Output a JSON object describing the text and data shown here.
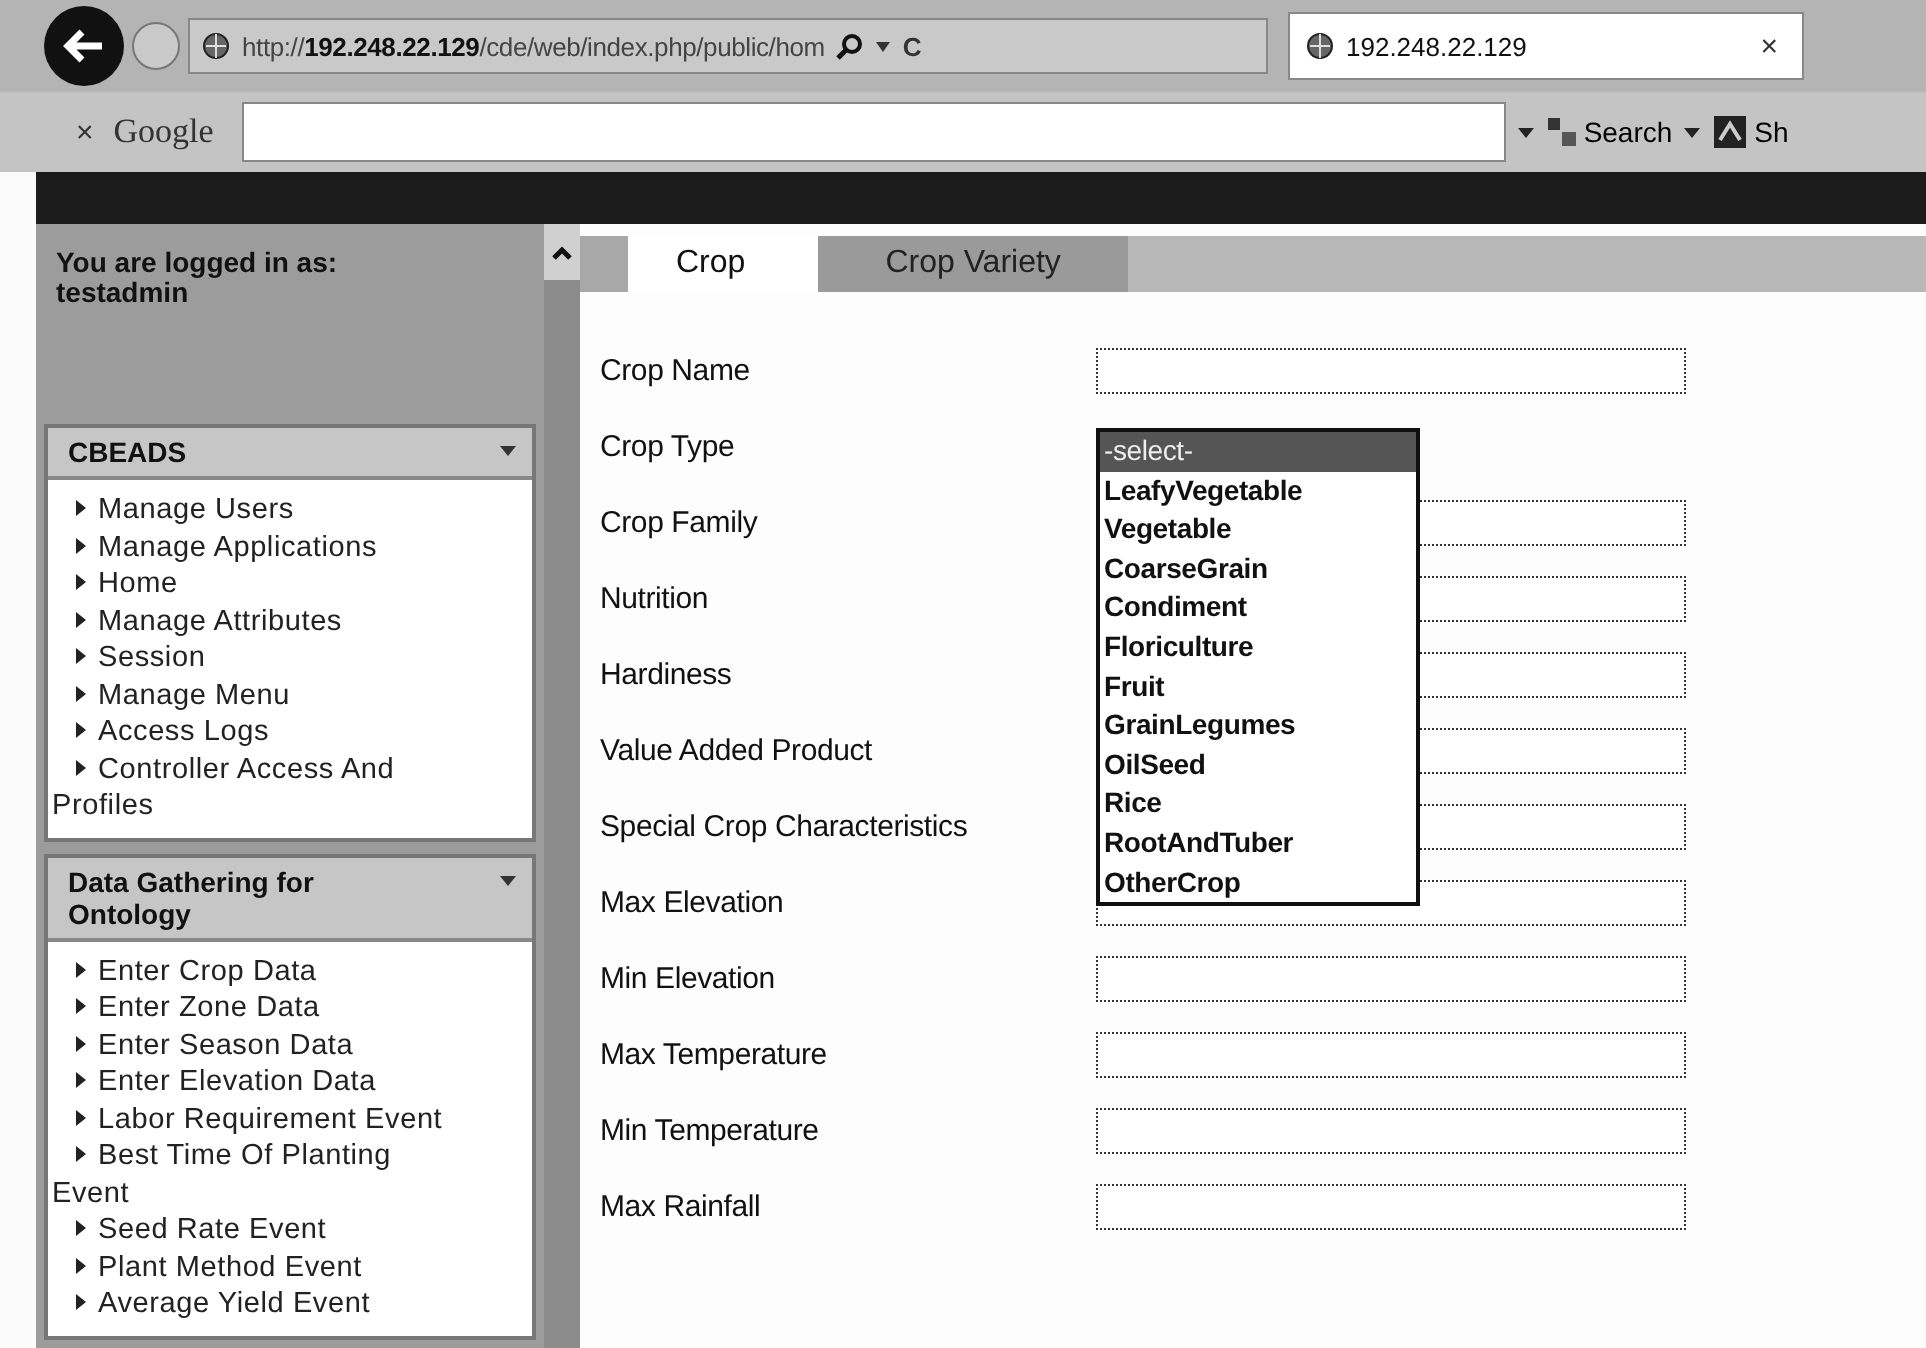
{
  "browser": {
    "url": "http://**192.248.22.129**/cde/web/index.php/public/hom",
    "refresh": "C",
    "tab": {
      "title": "192.248.22.129",
      "close": "×"
    }
  },
  "toolbar": {
    "close": "×",
    "brand": "Google",
    "search": "Search",
    "cut_button": "Sh"
  },
  "sidebar": {
    "login": "You are logged in as: testadmin",
    "panels": [
      {
        "title": "CBEADS",
        "items": [
          "Manage Users",
          "Manage Applications",
          "Home",
          "Manage Attributes",
          "Session",
          "Manage Menu",
          "Access Logs",
          "Controller Access And Profiles"
        ]
      },
      {
        "title": "Data Gathering for Ontology",
        "items": [
          "Enter Crop Data",
          "Enter Zone Data",
          "Enter Season Data",
          "Enter Elevation Data",
          "Labor Requirement Event",
          "Best Time Of Planting Event",
          "Seed Rate Event",
          "Plant Method Event",
          "Average Yield Event"
        ]
      }
    ]
  },
  "tabs": [
    {
      "label": "Crop",
      "selected": true
    },
    {
      "label": "Crop Variety",
      "selected": false
    }
  ],
  "fields": [
    {
      "kind": "text",
      "label": "Crop Name"
    },
    {
      "kind": "select",
      "label": "Crop Type",
      "options": [
        {
          "label": "-select-",
          "selected": true
        },
        {
          "label": "LeafyVegetable",
          "selected": false
        },
        {
          "label": "Vegetable",
          "selected": false
        },
        {
          "label": "CoarseGrain",
          "selected": false
        },
        {
          "label": "Condiment",
          "selected": false
        },
        {
          "label": "Floriculture",
          "selected": false
        },
        {
          "label": "Fruit",
          "selected": false
        },
        {
          "label": "GrainLegumes",
          "selected": false
        },
        {
          "label": "OilSeed",
          "selected": false
        },
        {
          "label": "Rice",
          "selected": false
        },
        {
          "label": "RootAndTuber",
          "selected": false
        },
        {
          "label": "OtherCrop",
          "selected": false
        }
      ]
    },
    {
      "kind": "text",
      "label": "Crop Family"
    },
    {
      "kind": "text",
      "label": "Nutrition"
    },
    {
      "kind": "text",
      "label": "Hardiness"
    },
    {
      "kind": "text",
      "label": "Value Added Product"
    },
    {
      "kind": "text",
      "label": "Special Crop Characteristics"
    },
    {
      "kind": "text",
      "label": "Max Elevation"
    },
    {
      "kind": "text",
      "label": "Min Elevation"
    },
    {
      "kind": "text",
      "label": "Max Temperature"
    },
    {
      "kind": "text",
      "label": "Min Temperature"
    },
    {
      "kind": "text",
      "label": "Max Rainfall"
    }
  ]
}
